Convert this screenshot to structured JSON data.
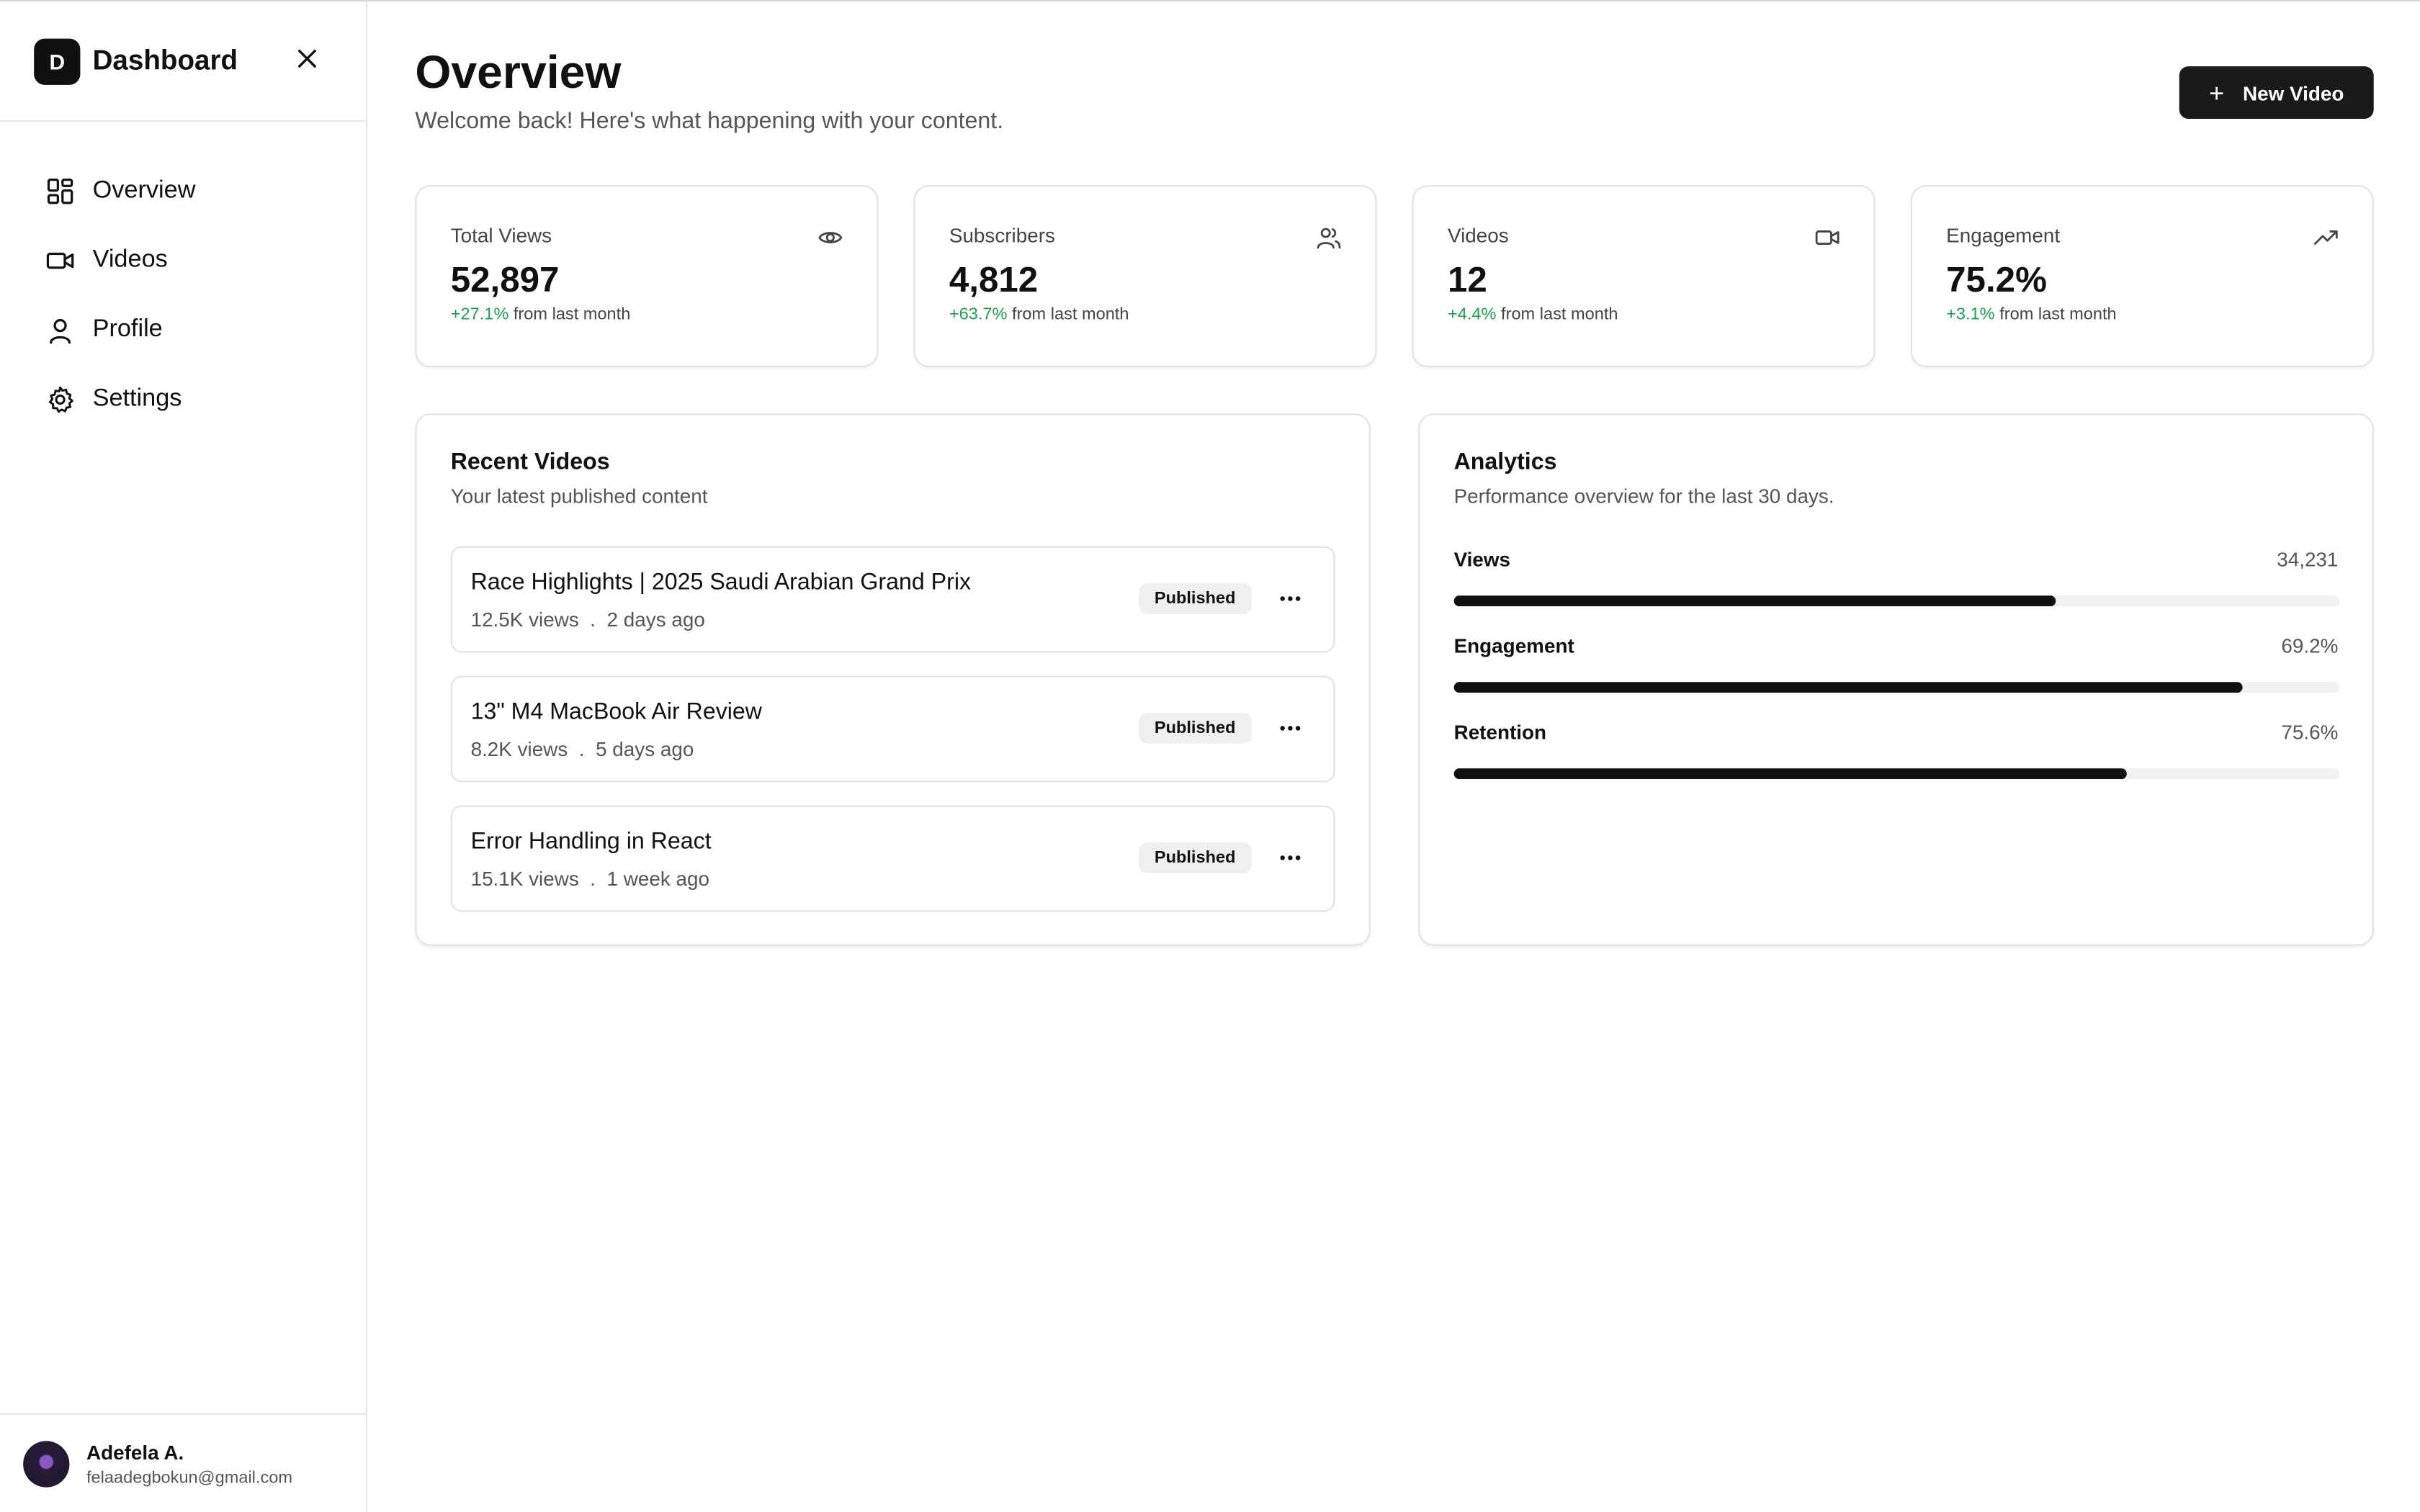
{
  "sidebar": {
    "logo_letter": "D",
    "brand": "Dashboard",
    "nav": [
      {
        "label": "Overview",
        "icon": "layout-grid-icon"
      },
      {
        "label": "Videos",
        "icon": "video-icon"
      },
      {
        "label": "Profile",
        "icon": "user-icon"
      },
      {
        "label": "Settings",
        "icon": "gear-icon"
      }
    ],
    "user": {
      "name": "Adefela A.",
      "email": "felaadegbokun@gmail.com"
    }
  },
  "header": {
    "title": "Overview",
    "subtitle": "Welcome back! Here's what happening with your content.",
    "new_button": "New Video"
  },
  "stats": [
    {
      "label": "Total Views",
      "value": "52,897",
      "change": "+27.1%",
      "suffix": " from last month",
      "icon": "eye-icon"
    },
    {
      "label": "Subscribers",
      "value": "4,812",
      "change": "+63.7%",
      "suffix": " from last month",
      "icon": "users-icon"
    },
    {
      "label": "Videos",
      "value": "12",
      "change": "+4.4%",
      "suffix": " from last month",
      "icon": "video-icon"
    },
    {
      "label": "Engagement",
      "value": "75.2%",
      "change": "+3.1%",
      "suffix": " from last month",
      "icon": "trending-up-icon"
    }
  ],
  "recent": {
    "title": "Recent Videos",
    "subtitle": "Your latest published content",
    "items": [
      {
        "title": "Race Highlights | 2025 Saudi Arabian Grand Prix",
        "views": "12.5K views",
        "sep": ".",
        "age": "2 days ago",
        "status": "Published"
      },
      {
        "title": "13\" M4 MacBook Air Review",
        "views": "8.2K views",
        "sep": ".",
        "age": "5 days ago",
        "status": "Published"
      },
      {
        "title": "Error Handling in React",
        "views": "15.1K views",
        "sep": ".",
        "age": "1 week ago",
        "status": "Published"
      }
    ]
  },
  "analytics": {
    "title": "Analytics",
    "subtitle": "Performance overview for the last 30 days.",
    "metrics": [
      {
        "label": "Views",
        "value": "34,231",
        "fill": 0.68
      },
      {
        "label": "Engagement",
        "value": "69.2%",
        "fill": 0.89
      },
      {
        "label": "Retention",
        "value": "75.6%",
        "fill": 0.76
      }
    ]
  },
  "colors": {
    "accent": "#111111",
    "positive": "#16a34a",
    "border": "#e3e3e3"
  }
}
